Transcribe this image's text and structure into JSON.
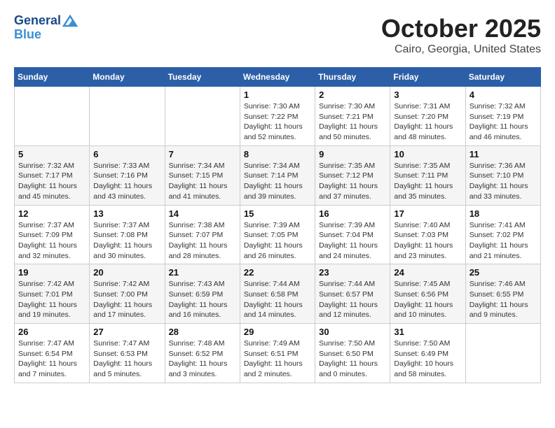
{
  "header": {
    "logo_line1": "General",
    "logo_line2": "Blue",
    "month": "October 2025",
    "location": "Cairo, Georgia, United States"
  },
  "weekdays": [
    "Sunday",
    "Monday",
    "Tuesday",
    "Wednesday",
    "Thursday",
    "Friday",
    "Saturday"
  ],
  "weeks": [
    [
      {
        "day": "",
        "sunrise": "",
        "sunset": "",
        "daylight": ""
      },
      {
        "day": "",
        "sunrise": "",
        "sunset": "",
        "daylight": ""
      },
      {
        "day": "",
        "sunrise": "",
        "sunset": "",
        "daylight": ""
      },
      {
        "day": "1",
        "sunrise": "Sunrise: 7:30 AM",
        "sunset": "Sunset: 7:22 PM",
        "daylight": "Daylight: 11 hours and 52 minutes."
      },
      {
        "day": "2",
        "sunrise": "Sunrise: 7:30 AM",
        "sunset": "Sunset: 7:21 PM",
        "daylight": "Daylight: 11 hours and 50 minutes."
      },
      {
        "day": "3",
        "sunrise": "Sunrise: 7:31 AM",
        "sunset": "Sunset: 7:20 PM",
        "daylight": "Daylight: 11 hours and 48 minutes."
      },
      {
        "day": "4",
        "sunrise": "Sunrise: 7:32 AM",
        "sunset": "Sunset: 7:19 PM",
        "daylight": "Daylight: 11 hours and 46 minutes."
      }
    ],
    [
      {
        "day": "5",
        "sunrise": "Sunrise: 7:32 AM",
        "sunset": "Sunset: 7:17 PM",
        "daylight": "Daylight: 11 hours and 45 minutes."
      },
      {
        "day": "6",
        "sunrise": "Sunrise: 7:33 AM",
        "sunset": "Sunset: 7:16 PM",
        "daylight": "Daylight: 11 hours and 43 minutes."
      },
      {
        "day": "7",
        "sunrise": "Sunrise: 7:34 AM",
        "sunset": "Sunset: 7:15 PM",
        "daylight": "Daylight: 11 hours and 41 minutes."
      },
      {
        "day": "8",
        "sunrise": "Sunrise: 7:34 AM",
        "sunset": "Sunset: 7:14 PM",
        "daylight": "Daylight: 11 hours and 39 minutes."
      },
      {
        "day": "9",
        "sunrise": "Sunrise: 7:35 AM",
        "sunset": "Sunset: 7:12 PM",
        "daylight": "Daylight: 11 hours and 37 minutes."
      },
      {
        "day": "10",
        "sunrise": "Sunrise: 7:35 AM",
        "sunset": "Sunset: 7:11 PM",
        "daylight": "Daylight: 11 hours and 35 minutes."
      },
      {
        "day": "11",
        "sunrise": "Sunrise: 7:36 AM",
        "sunset": "Sunset: 7:10 PM",
        "daylight": "Daylight: 11 hours and 33 minutes."
      }
    ],
    [
      {
        "day": "12",
        "sunrise": "Sunrise: 7:37 AM",
        "sunset": "Sunset: 7:09 PM",
        "daylight": "Daylight: 11 hours and 32 minutes."
      },
      {
        "day": "13",
        "sunrise": "Sunrise: 7:37 AM",
        "sunset": "Sunset: 7:08 PM",
        "daylight": "Daylight: 11 hours and 30 minutes."
      },
      {
        "day": "14",
        "sunrise": "Sunrise: 7:38 AM",
        "sunset": "Sunset: 7:07 PM",
        "daylight": "Daylight: 11 hours and 28 minutes."
      },
      {
        "day": "15",
        "sunrise": "Sunrise: 7:39 AM",
        "sunset": "Sunset: 7:05 PM",
        "daylight": "Daylight: 11 hours and 26 minutes."
      },
      {
        "day": "16",
        "sunrise": "Sunrise: 7:39 AM",
        "sunset": "Sunset: 7:04 PM",
        "daylight": "Daylight: 11 hours and 24 minutes."
      },
      {
        "day": "17",
        "sunrise": "Sunrise: 7:40 AM",
        "sunset": "Sunset: 7:03 PM",
        "daylight": "Daylight: 11 hours and 23 minutes."
      },
      {
        "day": "18",
        "sunrise": "Sunrise: 7:41 AM",
        "sunset": "Sunset: 7:02 PM",
        "daylight": "Daylight: 11 hours and 21 minutes."
      }
    ],
    [
      {
        "day": "19",
        "sunrise": "Sunrise: 7:42 AM",
        "sunset": "Sunset: 7:01 PM",
        "daylight": "Daylight: 11 hours and 19 minutes."
      },
      {
        "day": "20",
        "sunrise": "Sunrise: 7:42 AM",
        "sunset": "Sunset: 7:00 PM",
        "daylight": "Daylight: 11 hours and 17 minutes."
      },
      {
        "day": "21",
        "sunrise": "Sunrise: 7:43 AM",
        "sunset": "Sunset: 6:59 PM",
        "daylight": "Daylight: 11 hours and 16 minutes."
      },
      {
        "day": "22",
        "sunrise": "Sunrise: 7:44 AM",
        "sunset": "Sunset: 6:58 PM",
        "daylight": "Daylight: 11 hours and 14 minutes."
      },
      {
        "day": "23",
        "sunrise": "Sunrise: 7:44 AM",
        "sunset": "Sunset: 6:57 PM",
        "daylight": "Daylight: 11 hours and 12 minutes."
      },
      {
        "day": "24",
        "sunrise": "Sunrise: 7:45 AM",
        "sunset": "Sunset: 6:56 PM",
        "daylight": "Daylight: 11 hours and 10 minutes."
      },
      {
        "day": "25",
        "sunrise": "Sunrise: 7:46 AM",
        "sunset": "Sunset: 6:55 PM",
        "daylight": "Daylight: 11 hours and 9 minutes."
      }
    ],
    [
      {
        "day": "26",
        "sunrise": "Sunrise: 7:47 AM",
        "sunset": "Sunset: 6:54 PM",
        "daylight": "Daylight: 11 hours and 7 minutes."
      },
      {
        "day": "27",
        "sunrise": "Sunrise: 7:47 AM",
        "sunset": "Sunset: 6:53 PM",
        "daylight": "Daylight: 11 hours and 5 minutes."
      },
      {
        "day": "28",
        "sunrise": "Sunrise: 7:48 AM",
        "sunset": "Sunset: 6:52 PM",
        "daylight": "Daylight: 11 hours and 3 minutes."
      },
      {
        "day": "29",
        "sunrise": "Sunrise: 7:49 AM",
        "sunset": "Sunset: 6:51 PM",
        "daylight": "Daylight: 11 hours and 2 minutes."
      },
      {
        "day": "30",
        "sunrise": "Sunrise: 7:50 AM",
        "sunset": "Sunset: 6:50 PM",
        "daylight": "Daylight: 11 hours and 0 minutes."
      },
      {
        "day": "31",
        "sunrise": "Sunrise: 7:50 AM",
        "sunset": "Sunset: 6:49 PM",
        "daylight": "Daylight: 10 hours and 58 minutes."
      },
      {
        "day": "",
        "sunrise": "",
        "sunset": "",
        "daylight": ""
      }
    ]
  ]
}
